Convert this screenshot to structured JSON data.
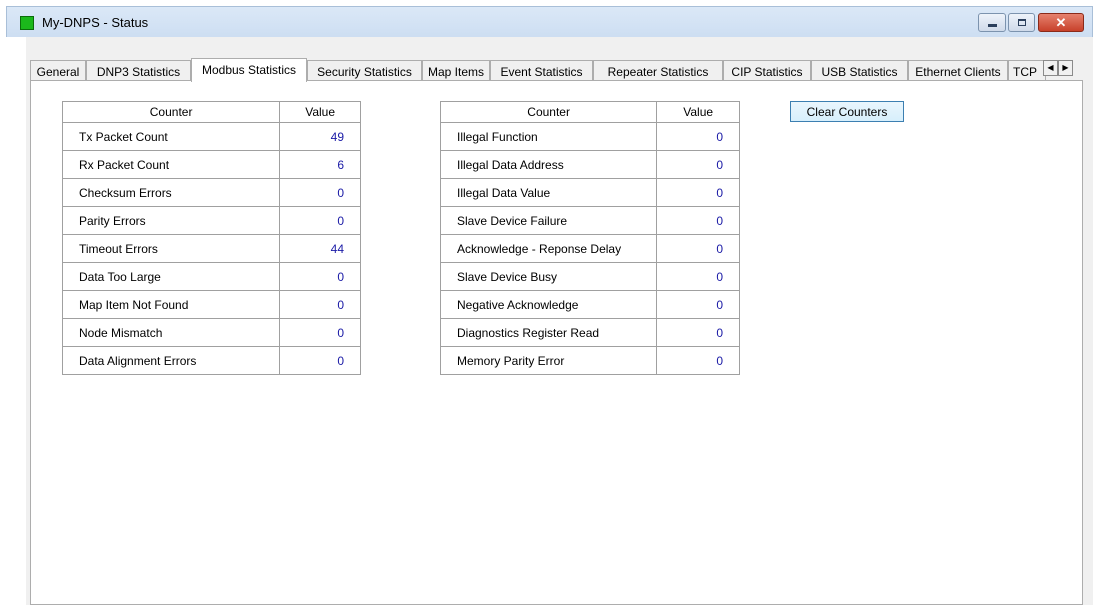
{
  "window": {
    "title": "My-DNPS - Status",
    "controls": {
      "minimize": "",
      "maximize": "",
      "close": "✕"
    }
  },
  "tabs": [
    {
      "label": "General",
      "active": false
    },
    {
      "label": "DNP3 Statistics",
      "active": false
    },
    {
      "label": "Modbus Statistics",
      "active": true
    },
    {
      "label": "Security Statistics",
      "active": false
    },
    {
      "label": "Map Items",
      "active": false
    },
    {
      "label": "Event Statistics",
      "active": false
    },
    {
      "label": "Repeater Statistics",
      "active": false
    },
    {
      "label": "CIP Statistics",
      "active": false
    },
    {
      "label": "USB Statistics",
      "active": false
    },
    {
      "label": "Ethernet Clients",
      "active": false
    },
    {
      "label": "TCP",
      "active": false
    }
  ],
  "tab_scroll": {
    "left": "◀",
    "right": "▶"
  },
  "table1": {
    "headers": [
      "Counter",
      "Value"
    ],
    "rows": [
      {
        "counter": "Tx Packet Count",
        "value": "49"
      },
      {
        "counter": "Rx Packet Count",
        "value": "6"
      },
      {
        "counter": "Checksum Errors",
        "value": "0"
      },
      {
        "counter": "Parity Errors",
        "value": "0"
      },
      {
        "counter": "Timeout Errors",
        "value": "44"
      },
      {
        "counter": "Data Too Large",
        "value": "0"
      },
      {
        "counter": "Map Item Not Found",
        "value": "0"
      },
      {
        "counter": "Node Mismatch",
        "value": "0"
      },
      {
        "counter": "Data Alignment Errors",
        "value": "0"
      }
    ]
  },
  "table2": {
    "headers": [
      "Counter",
      "Value"
    ],
    "rows": [
      {
        "counter": "Illegal Function",
        "value": "0"
      },
      {
        "counter": "Illegal Data Address",
        "value": "0"
      },
      {
        "counter": "Illegal Data Value",
        "value": "0"
      },
      {
        "counter": "Slave Device Failure",
        "value": "0"
      },
      {
        "counter": "Acknowledge - Reponse Delay",
        "value": "0"
      },
      {
        "counter": "Slave Device Busy",
        "value": "0"
      },
      {
        "counter": "Negative Acknowledge",
        "value": "0"
      },
      {
        "counter": "Diagnostics Register Read",
        "value": "0"
      },
      {
        "counter": "Memory Parity Error",
        "value": "0"
      }
    ]
  },
  "buttons": {
    "clear_counters": "Clear Counters"
  },
  "colors": {
    "value_text": "#1a1aa6",
    "app_icon": "#1bb81b",
    "close_button": "#c7412b"
  }
}
